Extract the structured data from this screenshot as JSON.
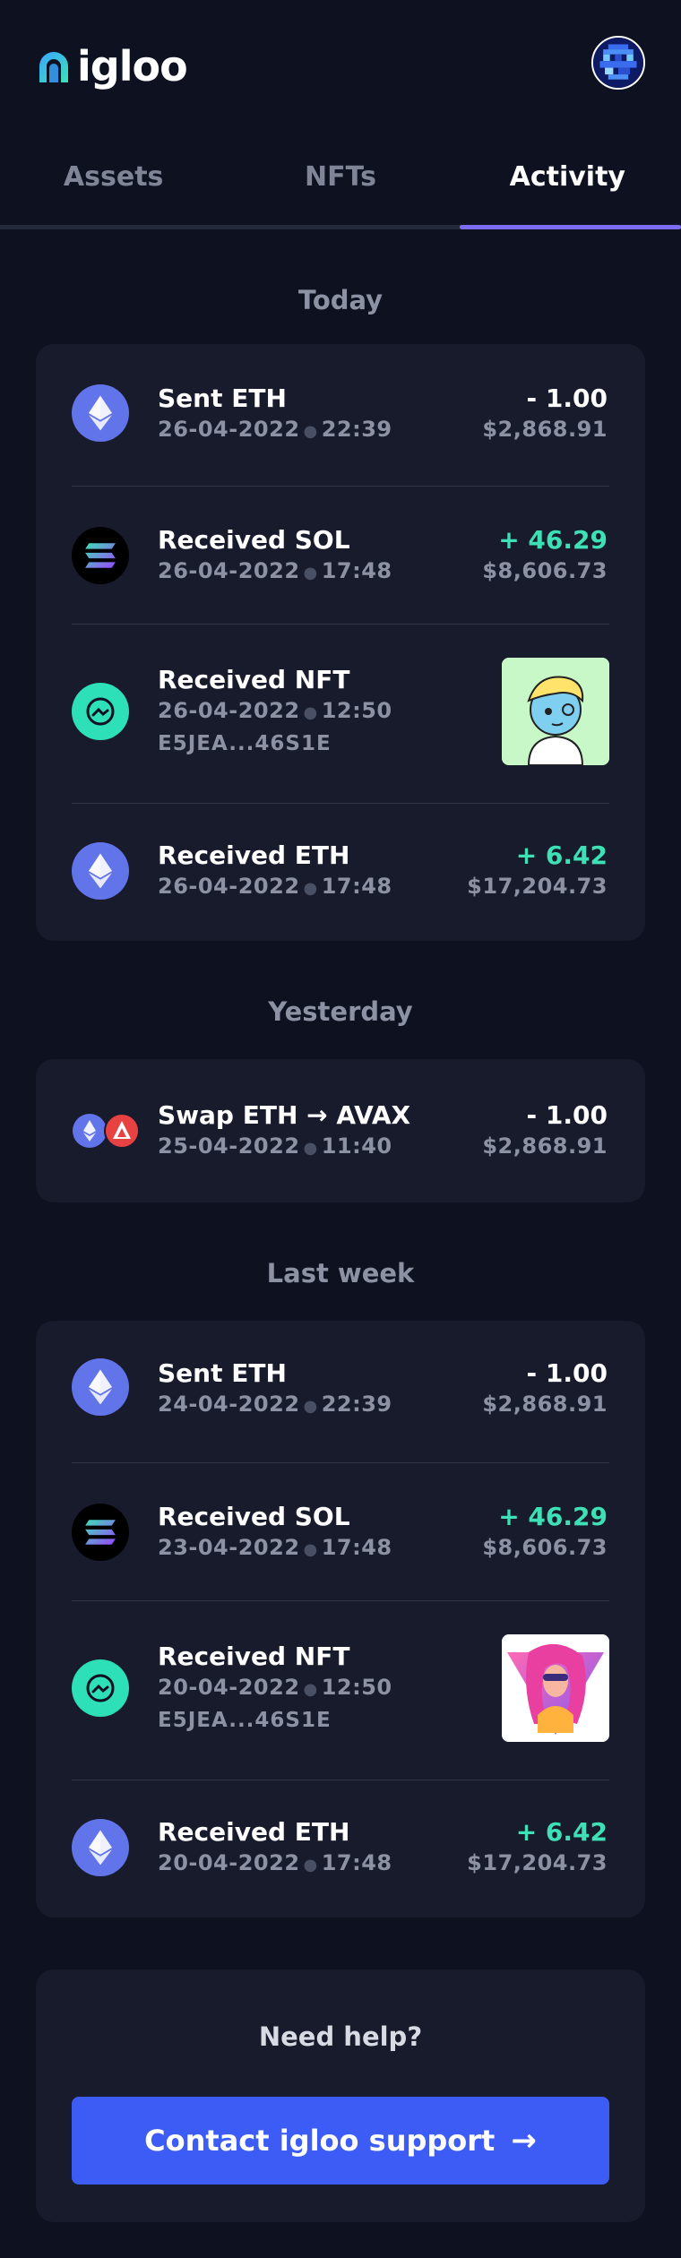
{
  "app": {
    "name": "igloo"
  },
  "tabs": [
    {
      "label": "Assets",
      "active": false
    },
    {
      "label": "NFTs",
      "active": false
    },
    {
      "label": "Activity",
      "active": true
    }
  ],
  "sections": {
    "today": {
      "title": "Today",
      "items": [
        {
          "title": "Sent ETH",
          "date": "26-04-2022",
          "time": "22:39",
          "amount": "- 1.00",
          "fiat": "$2,868.91",
          "icon": "eth-icon"
        },
        {
          "title": "Received SOL",
          "date": "26-04-2022",
          "time": "17:48",
          "amount": "+ 46.29",
          "fiat": "$8,606.73",
          "icon": "sol-icon"
        },
        {
          "title": "Received NFT",
          "date": "26-04-2022",
          "time": "12:50",
          "address": "E5JEA...46S1E",
          "icon": "nft-icon",
          "thumb": "nft-thumbnail-character"
        },
        {
          "title": "Received ETH",
          "date": "26-04-2022",
          "time": "17:48",
          "amount": "+ 6.42",
          "fiat": "$17,204.73",
          "icon": "eth-icon"
        }
      ]
    },
    "yesterday": {
      "title": "Yesterday",
      "items": [
        {
          "title": "Swap ETH  →  AVAX",
          "date": "25-04-2022",
          "time": "11:40",
          "amount": "- 1.00",
          "fiat": "$2,868.91",
          "icon": "swap-eth-avax-icon"
        }
      ]
    },
    "last_week": {
      "title": "Last week",
      "items": [
        {
          "title": "Sent ETH",
          "date": "24-04-2022",
          "time": "22:39",
          "amount": "- 1.00",
          "fiat": "$2,868.91",
          "icon": "eth-icon"
        },
        {
          "title": "Received SOL",
          "date": "23-04-2022",
          "time": "17:48",
          "amount": "+ 46.29",
          "fiat": "$8,606.73",
          "icon": "sol-icon"
        },
        {
          "title": "Received NFT",
          "date": "20-04-2022",
          "time": "12:50",
          "address": "E5JEA...46S1E",
          "icon": "nft-icon",
          "thumb": "nft-thumbnail-portrait"
        },
        {
          "title": "Received ETH",
          "date": "20-04-2022",
          "time": "17:48",
          "amount": "+ 6.42",
          "fiat": "$17,204.73",
          "icon": "eth-icon"
        }
      ]
    }
  },
  "help": {
    "title": "Need help?",
    "button_label": "Contact igloo support"
  },
  "colors": {
    "background": "#0d1120",
    "card": "#171b2b",
    "accent": "#7b6cf0",
    "positive": "#3ee0b6",
    "button": "#3d5cf5"
  }
}
